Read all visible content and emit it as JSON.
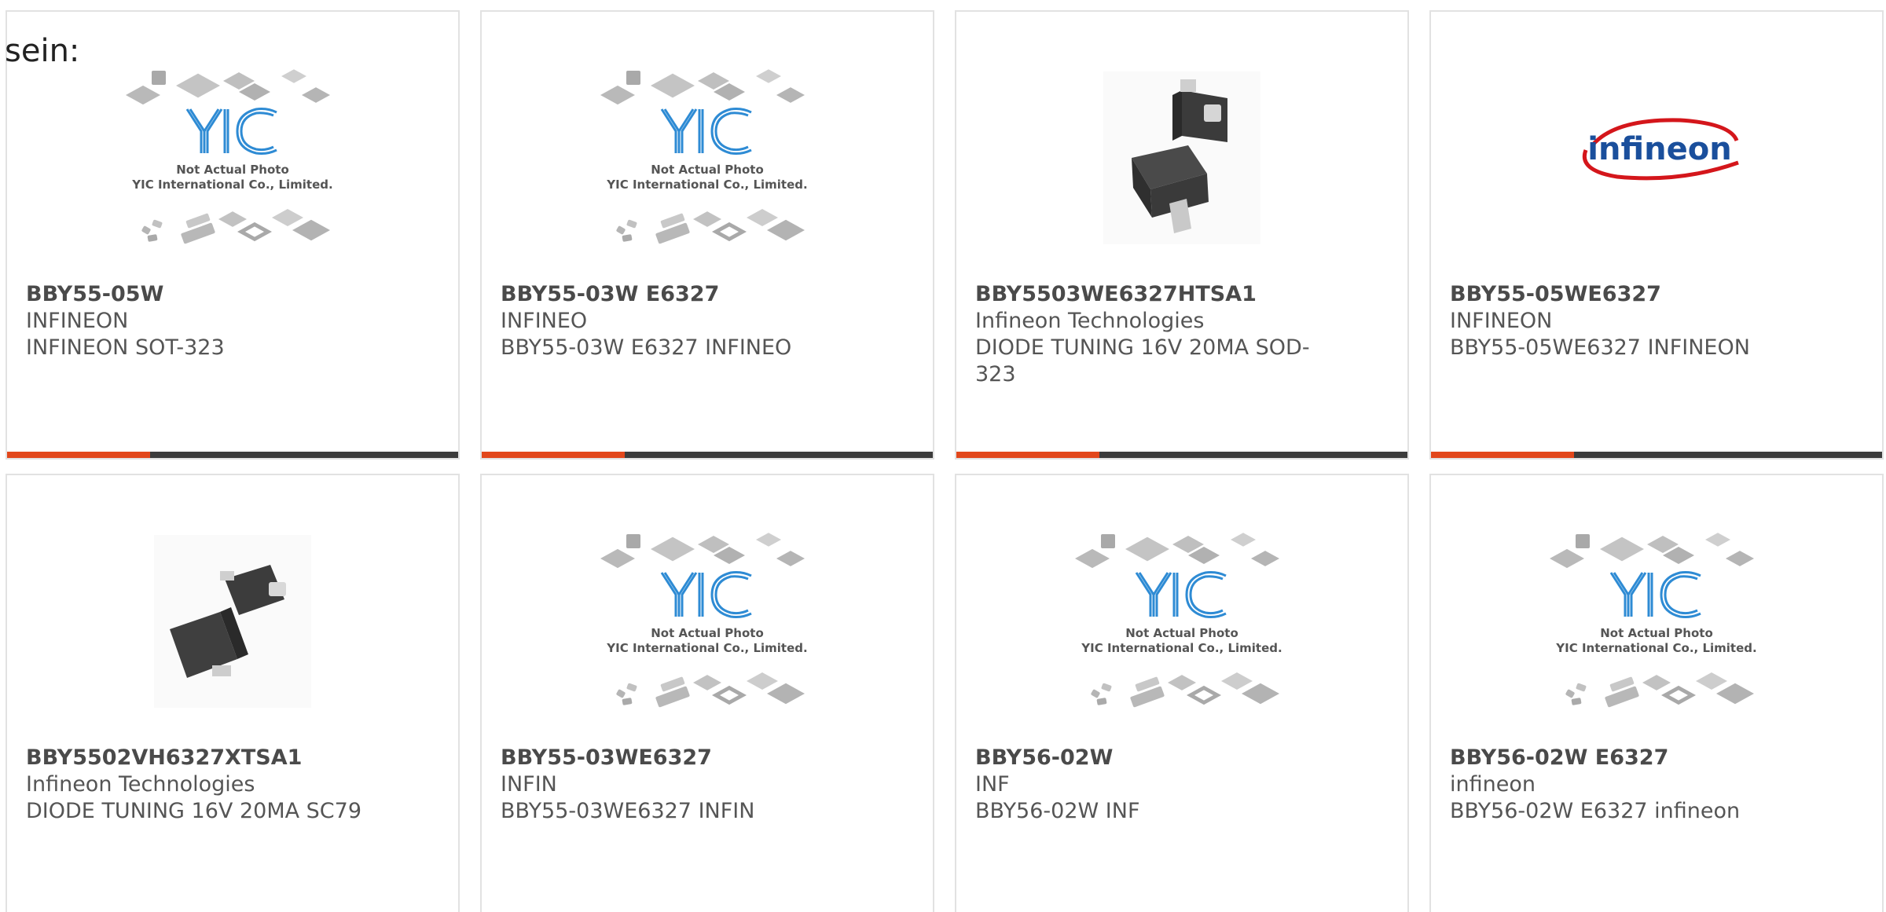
{
  "intro": {
    "text": "sein:"
  },
  "colors": {
    "accent": "#e2471b",
    "bar": "#3c3c3c",
    "yic_blue": "#2e8bd4",
    "infineon_red": "#d4161b",
    "infineon_blue": "#1a4f9c"
  },
  "placeholder": {
    "line1": "Not Actual Photo",
    "line2": "YIC International Co., Limited."
  },
  "brand_logo": {
    "text": "infineon"
  },
  "cards": [
    {
      "part": "BBY55-05W",
      "mfr": "INFINEON",
      "desc": "INFINEON SOT-323",
      "image": "not-actual-photo"
    },
    {
      "part": "BBY55-03W E6327",
      "mfr": "INFINEO",
      "desc": "BBY55-03W E6327 INFINEO",
      "image": "not-actual-photo"
    },
    {
      "part": "BBY5503WE6327HTSA1",
      "mfr": "Infineon Technologies",
      "desc": "DIODE TUNING 16V 20MA SOD-323",
      "image": "sod323-photo"
    },
    {
      "part": "BBY55-05WE6327",
      "mfr": "INFINEON",
      "desc": "BBY55-05WE6327 INFINEON",
      "image": "infineon-logo"
    },
    {
      "part": "BBY5502VH6327XTSA1",
      "mfr": "Infineon Technologies",
      "desc": "DIODE TUNING 16V 20MA SC79",
      "image": "sc79-photo"
    },
    {
      "part": "BBY55-03WE6327",
      "mfr": "INFIN",
      "desc": "BBY55-03WE6327 INFIN",
      "image": "not-actual-photo"
    },
    {
      "part": "BBY56-02W",
      "mfr": "INF",
      "desc": "BBY56-02W INF",
      "image": "not-actual-photo"
    },
    {
      "part": "BBY56-02W E6327",
      "mfr": "infineon",
      "desc": "BBY56-02W E6327 infineon",
      "image": "not-actual-photo"
    }
  ]
}
